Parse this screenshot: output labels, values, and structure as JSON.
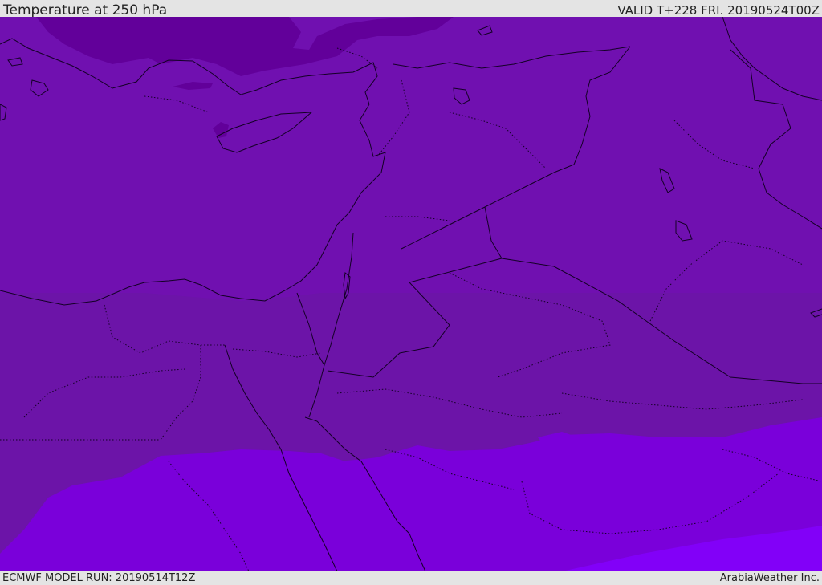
{
  "header": {
    "title": "Temperature at 250 hPa",
    "valid": "VALID T+228 FRI. 20190524T00Z"
  },
  "footer": {
    "model_run": "ECMWF MODEL RUN: 20190514T12Z",
    "credit": "ArabiaWeather Inc."
  },
  "colors": {
    "cold_band": "#62009a",
    "main": "#7010b0",
    "mid": "#6c14a8",
    "warm": "#7a00da",
    "warmest": "#8200f8",
    "lines": "#140026"
  }
}
